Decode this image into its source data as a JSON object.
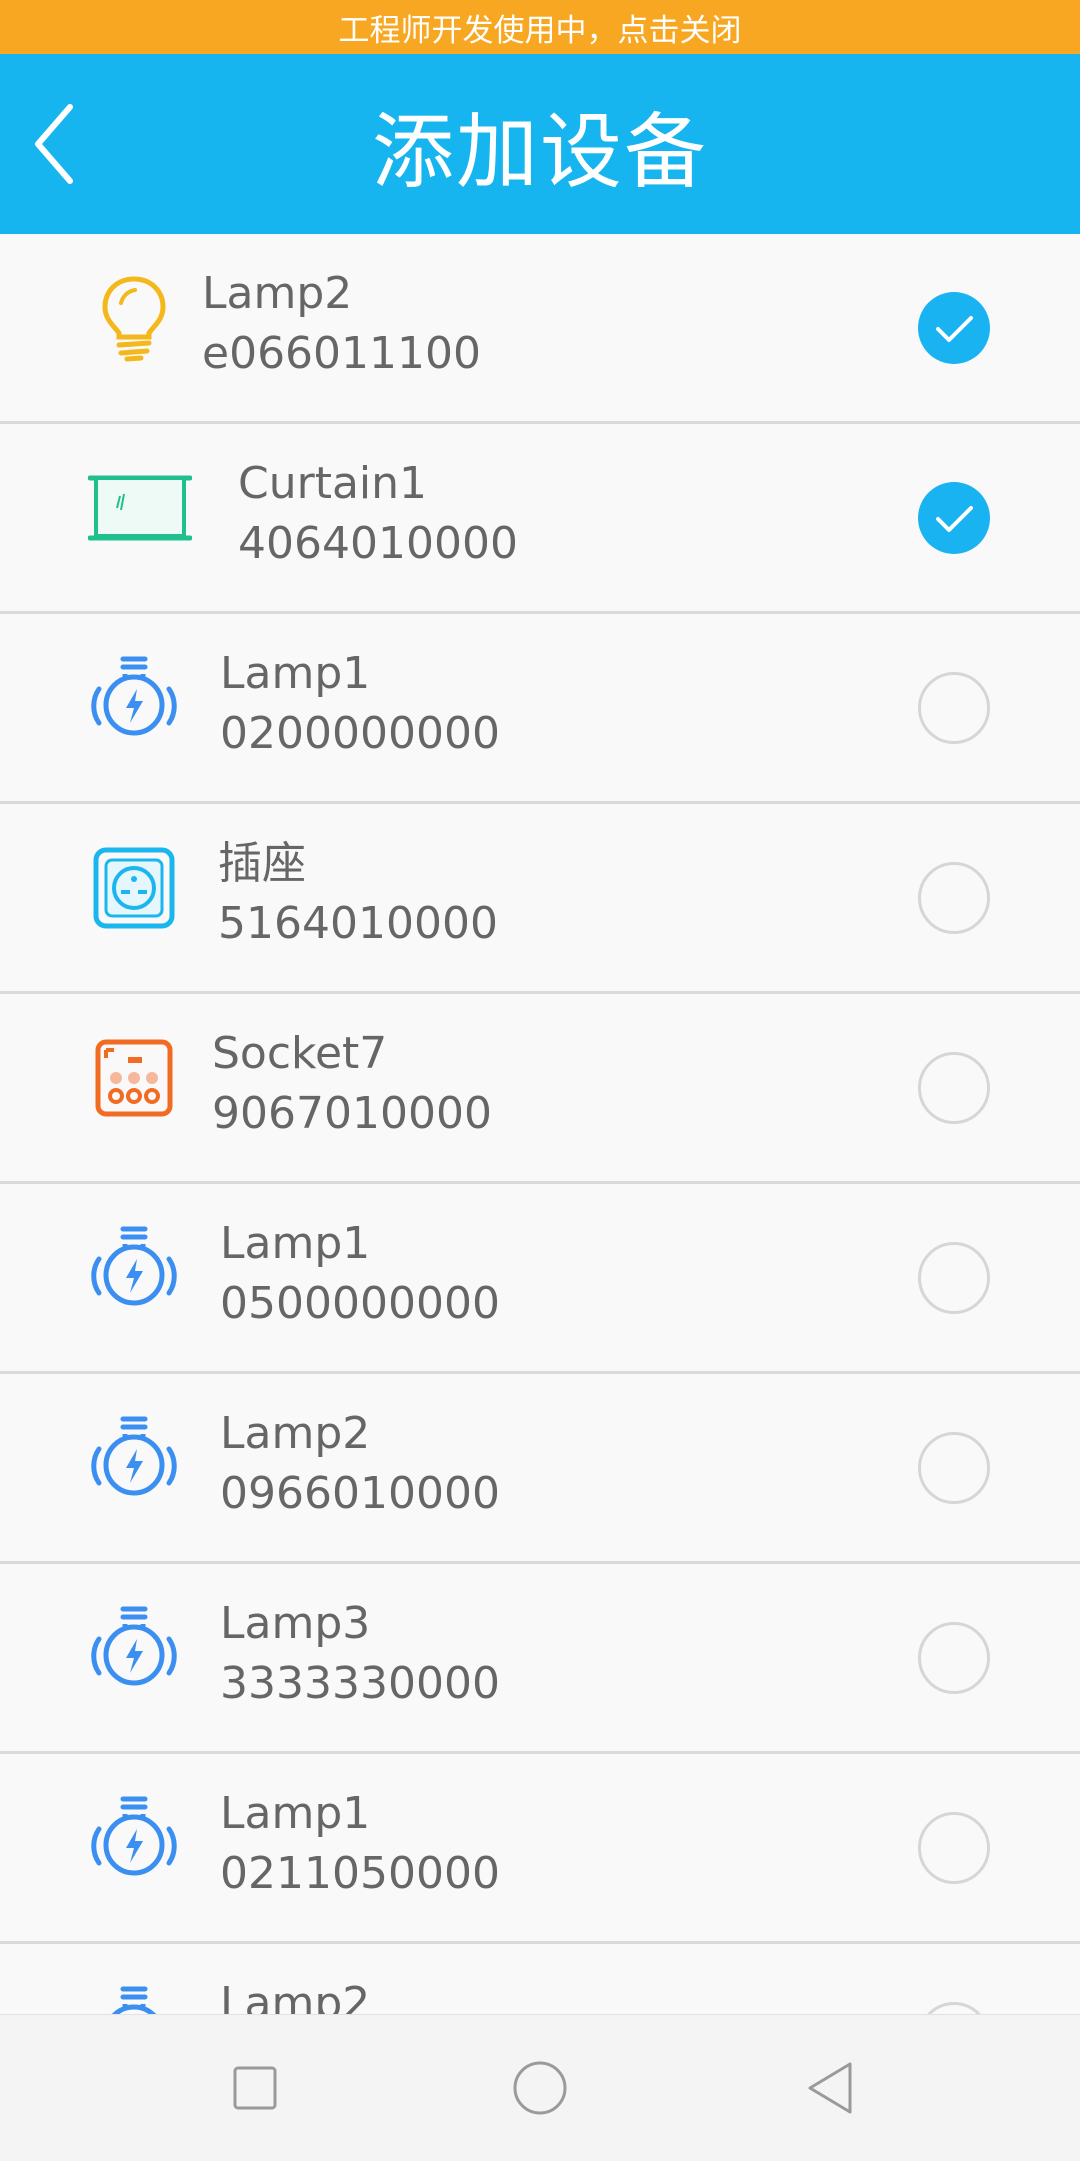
{
  "banner": {
    "text": "工程师开发使用中，点击关闭"
  },
  "header": {
    "title": "添加设备",
    "back_icon": "chevron-left-icon"
  },
  "colors": {
    "banner": "#f7a722",
    "header": "#17b5f0",
    "check_on": "#19b3f2",
    "text": "#666666"
  },
  "devices": [
    {
      "name": "Lamp2",
      "id": "e066011100",
      "icon": "bulb-yellow-icon",
      "checked": true
    },
    {
      "name": "Curtain1",
      "id": "4064010000",
      "icon": "curtain-icon",
      "checked": true
    },
    {
      "name": "Lamp1",
      "id": "0200000000",
      "icon": "smart-bulb-icon",
      "checked": false
    },
    {
      "name": "插座",
      "id": "5164010000",
      "icon": "wall-socket-icon",
      "checked": false
    },
    {
      "name": "Socket7",
      "id": "9067010000",
      "icon": "power-strip-icon",
      "checked": false
    },
    {
      "name": "Lamp1",
      "id": "0500000000",
      "icon": "smart-bulb-icon",
      "checked": false
    },
    {
      "name": "Lamp2",
      "id": "0966010000",
      "icon": "smart-bulb-icon",
      "checked": false
    },
    {
      "name": "Lamp3",
      "id": "3333330000",
      "icon": "smart-bulb-icon",
      "checked": false
    },
    {
      "name": "Lamp1",
      "id": "0211050000",
      "icon": "smart-bulb-icon",
      "checked": false
    },
    {
      "name": "Lamp2",
      "id": "",
      "icon": "smart-bulb-icon",
      "checked": false
    }
  ],
  "navbar": {
    "recent_icon": "square-icon",
    "home_icon": "circle-icon",
    "back_icon": "triangle-back-icon"
  }
}
